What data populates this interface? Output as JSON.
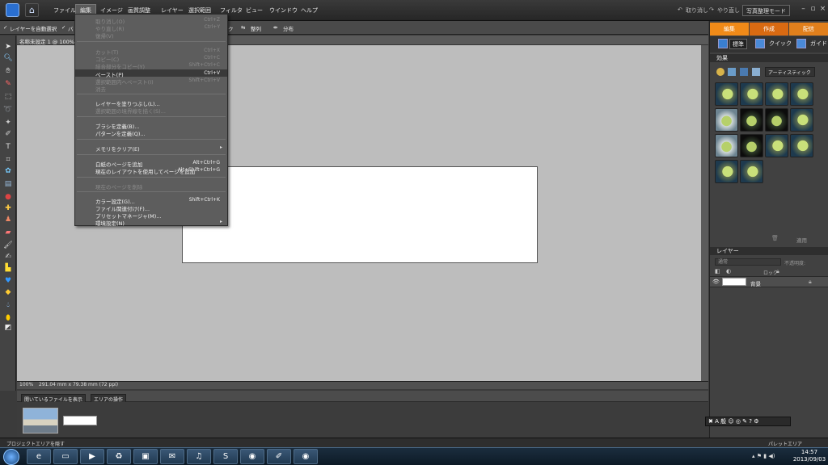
{
  "menubar": {
    "items": [
      "ファイル",
      "編集",
      "イメージ",
      "画質調整",
      "レイヤー",
      "選択範囲",
      "フィルタ",
      "ビュー",
      "ウインドウ",
      "ヘルプ"
    ],
    "undo": "取り消し",
    "redo": "やり直し",
    "mode_button": "写真整理モード"
  },
  "options": {
    "auto_select": "レイヤーを自動選択",
    "bounding": "バ",
    "arrange": "ク",
    "align": "整列",
    "distribute": "分布"
  },
  "doc_tab": "名称未設定 1 @ 100%(RGB/8)",
  "status": {
    "zoom": "100%",
    "size": "291.04 mm x 79.38 mm (72 ppi)"
  },
  "bin": {
    "show_open": "開いているファイルを表示",
    "area_ops": "エリアの操作"
  },
  "bottom": {
    "hide_project": "プロジェクトエリアを隠す",
    "palette": "パレットエリア"
  },
  "panel": {
    "tabs": [
      "編集",
      "作成",
      "配信"
    ],
    "subtabs": [
      "標準",
      "クイック",
      "ガイド"
    ],
    "effects_title": "効果",
    "effects_dropdown": "アーティスティック",
    "apply": "適用",
    "layers_title": "レイヤー",
    "blend": "通常",
    "opacity_label": "不透明度:",
    "lock": "ロック",
    "layer_name": "背景"
  },
  "edit_menu": [
    {
      "label": "取り消し(O)",
      "shortcut": "Ctrl+Z",
      "disabled": true
    },
    {
      "label": "やり直し(R)",
      "shortcut": "Ctrl+Y",
      "disabled": true
    },
    {
      "label": "復帰(V)",
      "shortcut": "",
      "disabled": true
    },
    {
      "label": "カット(T)",
      "shortcut": "Ctrl+X",
      "disabled": true
    },
    {
      "label": "コピー(C)",
      "shortcut": "Ctrl+C",
      "disabled": true
    },
    {
      "label": "結合部分をコピー(Y)",
      "shortcut": "Shift+Ctrl+C",
      "disabled": true
    },
    {
      "label": "ペースト(P)",
      "shortcut": "Ctrl+V",
      "disabled": false
    },
    {
      "label": "選択範囲内へペースト(I)",
      "shortcut": "Shift+Ctrl+V",
      "disabled": true
    },
    {
      "label": "消去",
      "shortcut": "",
      "disabled": true
    },
    {
      "label": "レイヤーを塗りつぶし(L)...",
      "shortcut": "",
      "disabled": false
    },
    {
      "label": "選択範囲の境界線を描く(S)...",
      "shortcut": "",
      "disabled": true
    },
    {
      "label": "ブラシを定義(B)...",
      "shortcut": "",
      "disabled": false
    },
    {
      "label": "パターンを定義(Q)...",
      "shortcut": "",
      "disabled": false
    },
    {
      "label": "メモリをクリア(E)",
      "shortcut": "",
      "disabled": false
    },
    {
      "label": "白紙のページを追加",
      "shortcut": "Alt+Ctrl+G",
      "disabled": false
    },
    {
      "label": "現在のレイアウトを使用してページを追加",
      "shortcut": "Alt+Shift+Ctrl+G",
      "disabled": false
    },
    {
      "label": "現在のページを削除",
      "shortcut": "",
      "disabled": true
    },
    {
      "label": "カラー設定(G)...",
      "shortcut": "Shift+Ctrl+K",
      "disabled": false
    },
    {
      "label": "ファイル関連付け(F)...",
      "shortcut": "",
      "disabled": false
    },
    {
      "label": "プリセットマネージャ(M)...",
      "shortcut": "",
      "disabled": false
    },
    {
      "label": "環境設定(N)",
      "shortcut": "",
      "disabled": false
    }
  ],
  "taskbar": {
    "time": "14:57",
    "date": "2013/09/03"
  },
  "colors": {
    "accent_orange": "#f08a18",
    "canvas_bg": "#bdbdbd",
    "menu_bg": "#5d5d5d"
  }
}
